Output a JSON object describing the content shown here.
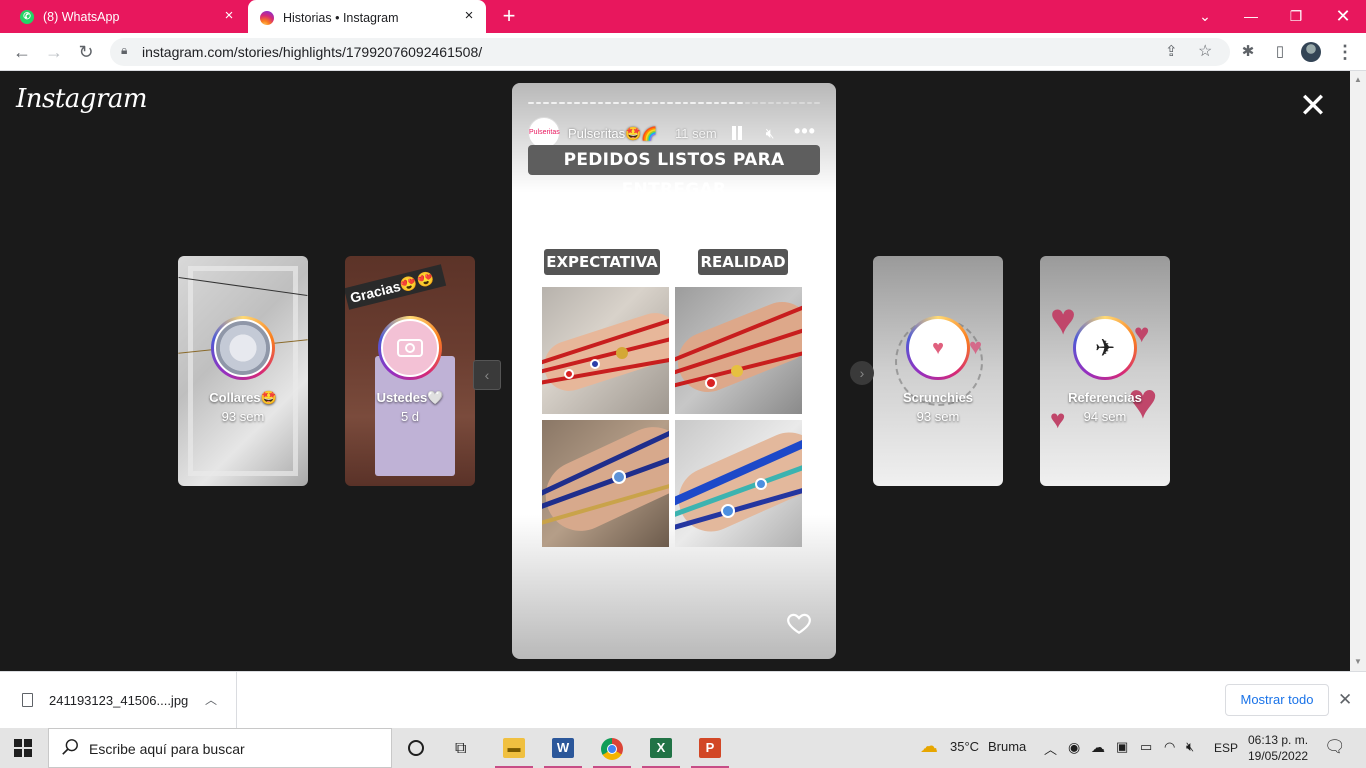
{
  "browser": {
    "tabs": [
      {
        "label": "(8) WhatsApp",
        "favicon": "whatsapp-icon",
        "active": false
      },
      {
        "label": "Historias • Instagram",
        "favicon": "instagram-icon",
        "active": true
      }
    ],
    "address": "instagram.com/stories/highlights/17992076092461508/",
    "accent": "#e8175d"
  },
  "page": {
    "logo": "Instagram"
  },
  "side_highlights": [
    {
      "name": "Collares🤩",
      "age": "93 sem"
    },
    {
      "name": "Ustedes🤍",
      "age": "5 d",
      "overlay_text": "Gracias😍😍"
    },
    {
      "name": "Scrunchies",
      "age": "93 sem"
    },
    {
      "name": "Referencias",
      "age": "94 sem"
    }
  ],
  "story": {
    "username": "Pulseritas🤩🌈",
    "timestamp": "11 sem",
    "banner": "PEDIDOS LISTOS PARA ENTREGAR",
    "label_left": "EXPECTATIVA",
    "label_right": "REALIDAD",
    "avatar_text": "Pulseritas",
    "progress_segments": 38,
    "progress_current": 28
  },
  "downloads": {
    "file_name": "241193123_41506....jpg",
    "show_all": "Mostrar todo"
  },
  "taskbar": {
    "search_placeholder": "Escribe aquí para buscar",
    "weather_temp": "35°C",
    "weather_desc": "Bruma",
    "language": "ESP",
    "time": "06:13 p. m.",
    "date": "19/05/2022"
  }
}
